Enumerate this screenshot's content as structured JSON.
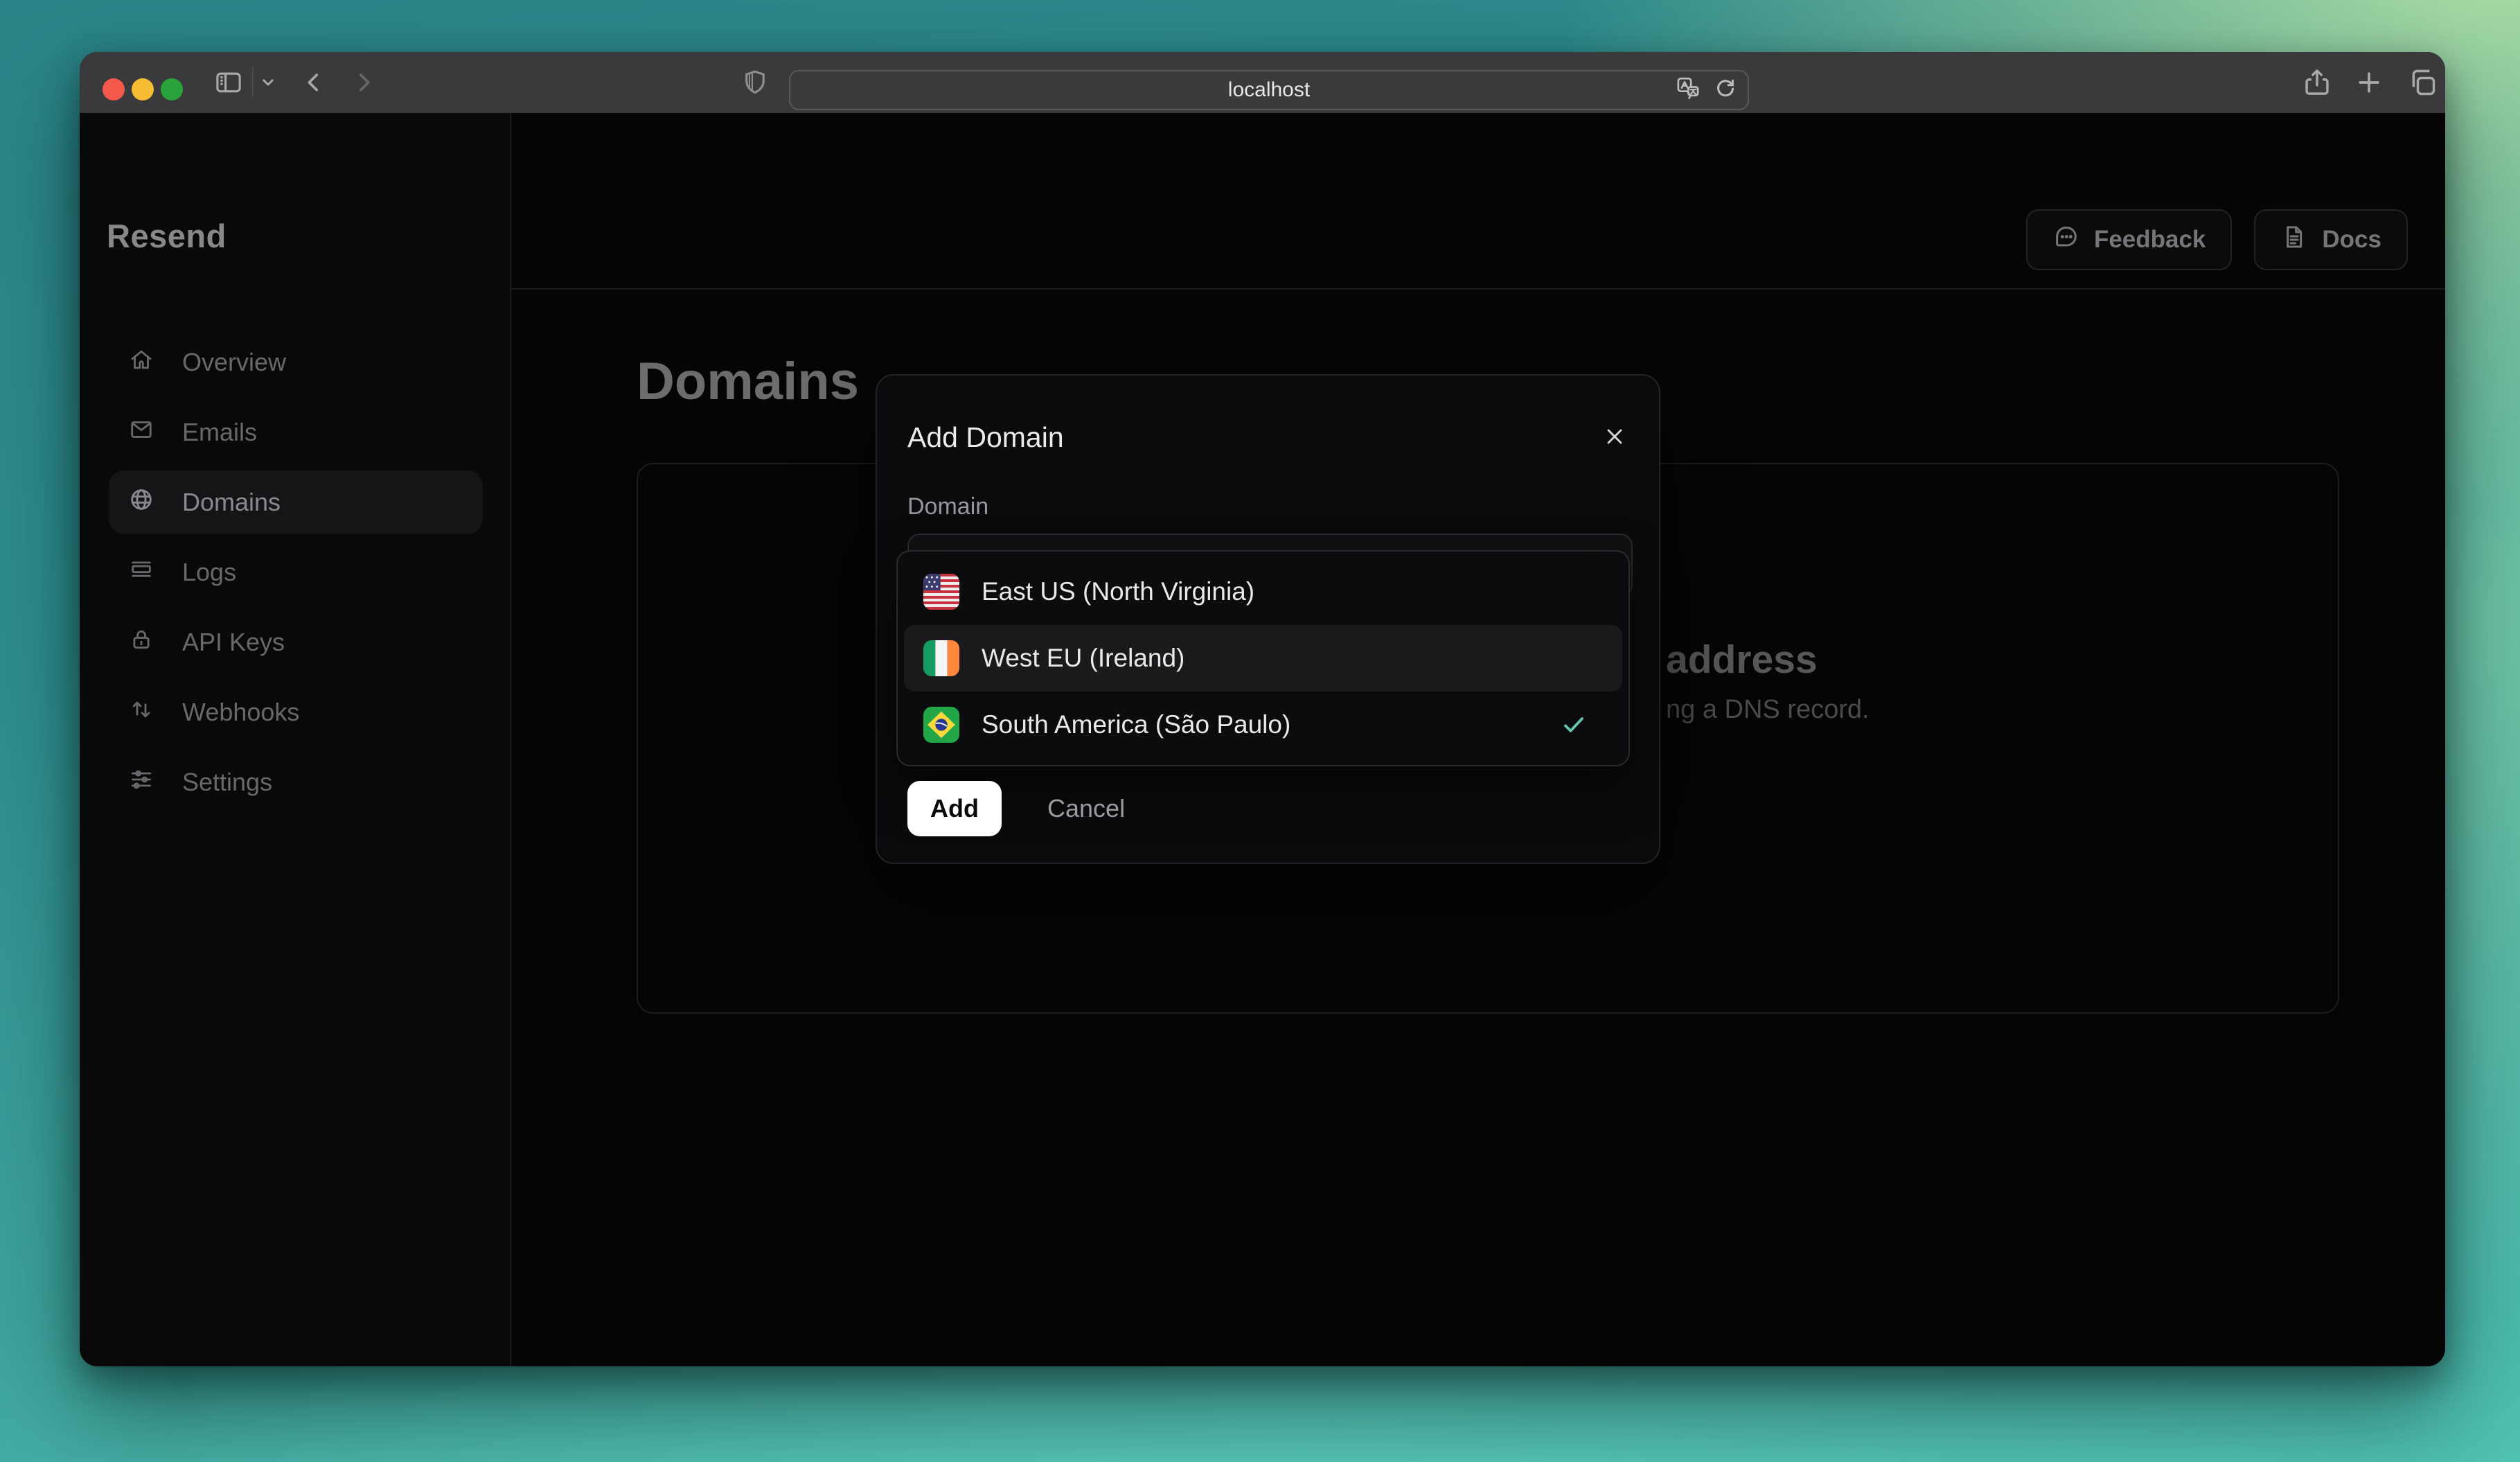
{
  "browser": {
    "url": "localhost",
    "traffic_lights": {
      "close": "red",
      "minimize": "yellow",
      "zoom": "green"
    },
    "icons": [
      "sidebar-toggle",
      "chevron-down",
      "back",
      "forward",
      "shield",
      "translate",
      "reload",
      "share",
      "new-tab",
      "tab-overview"
    ]
  },
  "sidebar": {
    "logo": "Resend",
    "items": [
      {
        "label": "Overview",
        "icon": "home-icon",
        "active": false
      },
      {
        "label": "Emails",
        "icon": "mail-icon",
        "active": false
      },
      {
        "label": "Domains",
        "icon": "globe-icon",
        "active": true
      },
      {
        "label": "Logs",
        "icon": "logs-icon",
        "active": false
      },
      {
        "label": "API Keys",
        "icon": "lock-icon",
        "active": false
      },
      {
        "label": "Webhooks",
        "icon": "webhooks-icon",
        "active": false
      },
      {
        "label": "Settings",
        "icon": "settings-icon",
        "active": false
      }
    ]
  },
  "header": {
    "feedback_label": "Feedback",
    "docs_label": "Docs"
  },
  "main": {
    "title": "Domains",
    "empty_state": {
      "heading_fragment": "address",
      "description_fragment": "ng a DNS record."
    }
  },
  "modal": {
    "title": "Add Domain",
    "field_label": "Domain",
    "options": [
      {
        "label": "East US (North Virginia)",
        "flag": "us-flag-icon",
        "highlighted": false,
        "selected": false
      },
      {
        "label": "West EU (Ireland)",
        "flag": "ireland-flag-icon",
        "highlighted": true,
        "selected": false
      },
      {
        "label": "South America (São Paulo)",
        "flag": "brazil-flag-icon",
        "highlighted": false,
        "selected": true
      }
    ],
    "add_label": "Add",
    "cancel_label": "Cancel"
  },
  "colors": {
    "check_accent": "#63c6ae",
    "modal_bg": "#0b0b0d",
    "highlight_row": "#1a1a1d",
    "titlebar": "#3a3a3c",
    "wallpaper_teal": "#2e8d8e",
    "wallpaper_green": "#a9dba3",
    "add_button_bg": "#ffffff"
  }
}
